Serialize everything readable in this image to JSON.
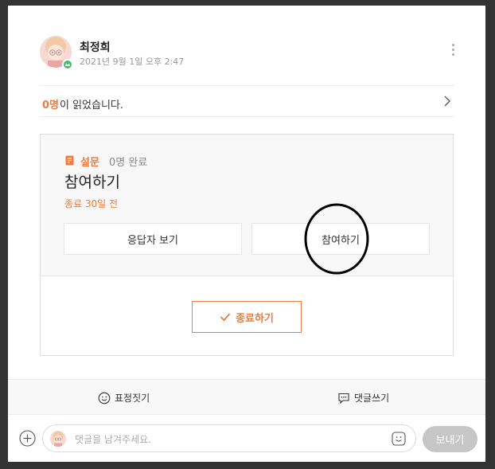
{
  "post": {
    "author": "최정희",
    "date": "2021년 9월 1일 오후 2:47"
  },
  "read": {
    "count": "0명",
    "text": "이 읽었습니다."
  },
  "survey": {
    "label": "설문",
    "completed": "0명 완료",
    "title": "참여하기",
    "deadline": "종료 30일 전",
    "responders_button": "응답자 보기",
    "join_button": "참여하기",
    "end_button": "종료하기"
  },
  "actions": {
    "emotion": "표정짓기",
    "comment": "댓글쓰기"
  },
  "comment": {
    "placeholder": "댓글을 남겨주세요.",
    "send": "보내기"
  },
  "colors": {
    "accent": "#f07b3f",
    "online": "#3cbf6d"
  },
  "icons": [
    "more-icon",
    "chevron-right-icon",
    "survey-icon",
    "check-icon",
    "smile-icon",
    "comment-icon",
    "plus-icon"
  ]
}
